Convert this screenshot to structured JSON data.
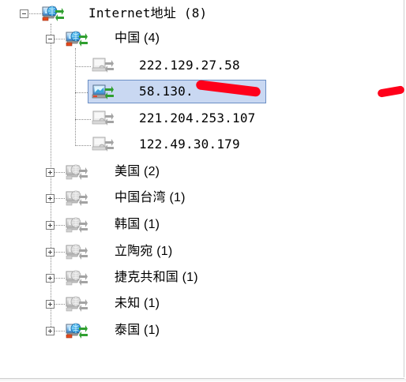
{
  "tree": {
    "root": {
      "label": "Internet地址 (8)",
      "expanded": true,
      "icon": "network-computer-green-icon"
    },
    "china": {
      "label": "中国 (4)",
      "expanded": true,
      "icon": "network-computer-green-icon",
      "children": [
        {
          "label": "222.129.27.58",
          "icon": "computer-offline-icon",
          "selected": false
        },
        {
          "label": "58.130.",
          "icon": "computer-online-icon",
          "selected": true,
          "partially_redacted": true
        },
        {
          "label": "221.204.253.107",
          "icon": "computer-offline-icon",
          "selected": false
        },
        {
          "label": "122.49.30.179",
          "icon": "computer-offline-icon",
          "selected": false
        }
      ]
    },
    "countries": [
      {
        "label": "美国 (2)",
        "expanded": false,
        "icon": "network-computer-gray-icon"
      },
      {
        "label": "中国台湾 (1)",
        "expanded": false,
        "icon": "network-computer-gray-icon"
      },
      {
        "label": "韩国 (1)",
        "expanded": false,
        "icon": "network-computer-gray-icon"
      },
      {
        "label": "立陶宛 (1)",
        "expanded": false,
        "icon": "network-computer-gray-icon"
      },
      {
        "label": "捷克共和国 (1)",
        "expanded": false,
        "icon": "network-computer-gray-icon"
      },
      {
        "label": "未知 (1)",
        "expanded": false,
        "icon": "network-computer-gray-icon"
      },
      {
        "label": "泰国 (1)",
        "expanded": false,
        "icon": "network-computer-green-icon"
      }
    ]
  },
  "colors": {
    "selection_fill": "#c9d8f2",
    "selection_border": "#6b8fc5",
    "redaction_red": "#ff001a",
    "active_arrow_green": "#2f9f2f",
    "inactive_arrow_gray": "#a3a3a3"
  }
}
